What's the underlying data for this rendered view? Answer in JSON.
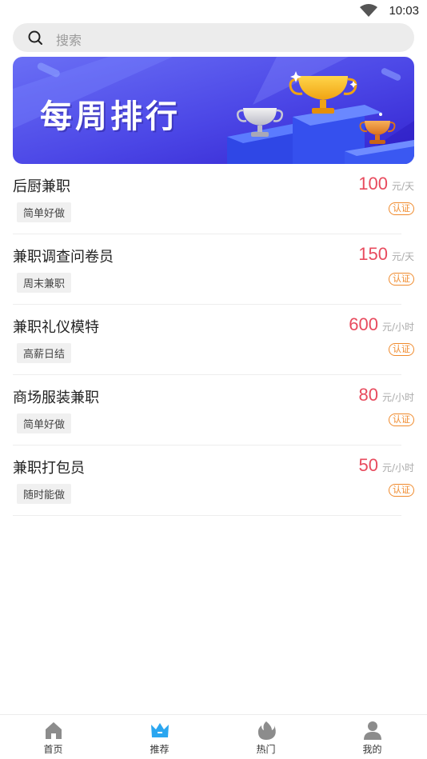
{
  "status_bar": {
    "time": "10:03"
  },
  "search": {
    "placeholder": "搜索"
  },
  "banner": {
    "title": "每周排行"
  },
  "jobs": [
    {
      "title": "后厨兼职",
      "tag": "简单好做",
      "amount": "100",
      "unit": "元/天",
      "badge": "认证"
    },
    {
      "title": "兼职调查问卷员",
      "tag": "周末兼职",
      "amount": "150",
      "unit": "元/天",
      "badge": "认证"
    },
    {
      "title": "兼职礼仪模特",
      "tag": "高薪日结",
      "amount": "600",
      "unit": "元/小时",
      "badge": "认证"
    },
    {
      "title": "商场服装兼职",
      "tag": "简单好做",
      "amount": "80",
      "unit": "元/小时",
      "badge": "认证"
    },
    {
      "title": "兼职打包员",
      "tag": "随时能做",
      "amount": "50",
      "unit": "元/小时",
      "badge": "认证"
    }
  ],
  "tabs": [
    {
      "label": "首页",
      "icon": "home-icon"
    },
    {
      "label": "推荐",
      "icon": "crown-icon",
      "active": true
    },
    {
      "label": "热门",
      "icon": "fire-icon"
    },
    {
      "label": "我的",
      "icon": "user-icon"
    }
  ],
  "colors": {
    "salary": "#e84b5e",
    "badge": "#f08a2c",
    "active_tab": "#2aa6f0",
    "banner_start": "#5a63f0",
    "banner_end": "#3a2fd6"
  }
}
